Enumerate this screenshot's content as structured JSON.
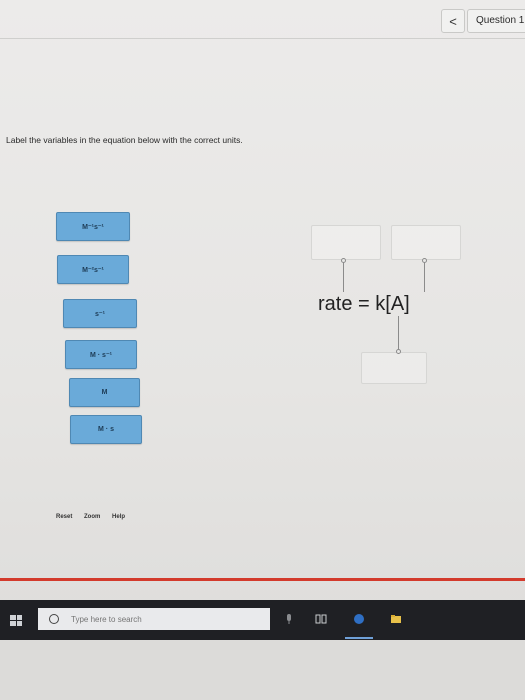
{
  "header": {
    "back_glyph": "<",
    "question_label": "Question 1!"
  },
  "instruction": "Label the variables in the equation below with the correct units.",
  "tiles": [
    {
      "text": "M⁻¹s⁻¹"
    },
    {
      "text": "M⁻²s⁻¹"
    },
    {
      "text": "s⁻¹"
    },
    {
      "text": "M · s⁻¹"
    },
    {
      "text": "M"
    },
    {
      "text": "M · s"
    }
  ],
  "equation": "rate = k[A]",
  "controls": {
    "reset": "Reset",
    "zoom": "Zoom",
    "help": "Help"
  },
  "taskbar": {
    "search_placeholder": "Type here to search"
  },
  "colors": {
    "tile": "#6aaad9",
    "accent_line": "#d33a2c",
    "taskbar": "#1f2024"
  }
}
